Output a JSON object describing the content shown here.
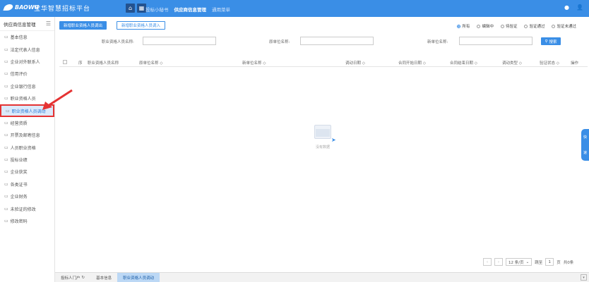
{
  "header": {
    "logo_text": "BAOWU",
    "app_title": "宝华智慧招标平台",
    "nav": [
      "投标小秘书",
      "供应商信息管理",
      "通用菜单"
    ],
    "active_nav": "供应商信息管理"
  },
  "sidebar": {
    "title": "供应商信息管理",
    "items": [
      {
        "label": "基本信息"
      },
      {
        "label": "法定代表人信息"
      },
      {
        "label": "企业对外联系人"
      },
      {
        "label": "信用评价"
      },
      {
        "label": "企业银行信息"
      },
      {
        "label": "职业资格人员"
      },
      {
        "label": "职业资格人员调动"
      },
      {
        "label": "经营资质"
      },
      {
        "label": "开票及邮寄信息"
      },
      {
        "label": "人员职业资格"
      },
      {
        "label": "投标业绩"
      },
      {
        "label": "企业获奖"
      },
      {
        "label": "各类证书"
      },
      {
        "label": "企业财务"
      },
      {
        "label": "未验证的修改"
      },
      {
        "label": "修改密码"
      }
    ],
    "active_index": 6
  },
  "toolbar": {
    "primary_label": "新增职业资格人员调出",
    "secondary_label": "新增职业资格人员调入",
    "radios": [
      "所有",
      "编辑中",
      "待验证",
      "验证通过",
      "验证未通过"
    ],
    "selected_radio": 0
  },
  "filters": {
    "person_label": "职业资格人员名称:",
    "orig_unit_label": "原单位名称:",
    "new_unit_label": "新单位名称:",
    "search_label": "搜索"
  },
  "table": {
    "columns": [
      "序",
      "职业资格人员名称",
      "原单位名称 ◇",
      "新单位名称 ◇",
      "调动日期 ◇",
      "合同开始日期 ◇",
      "合同结束日期 ◇",
      "调动类型 ◇",
      "验证状态 ◇",
      "操作"
    ],
    "empty_text": "没有数据"
  },
  "pager": {
    "page_size": "12 条/页",
    "goto_label": "跳至",
    "page": "1",
    "page_suffix": "页",
    "total": "共0条"
  },
  "bottom_tabs": [
    "投标人门户",
    "基本信息",
    "职业资格人员调动"
  ],
  "float_widget": {
    "label1": "快",
    "label2": "速"
  }
}
